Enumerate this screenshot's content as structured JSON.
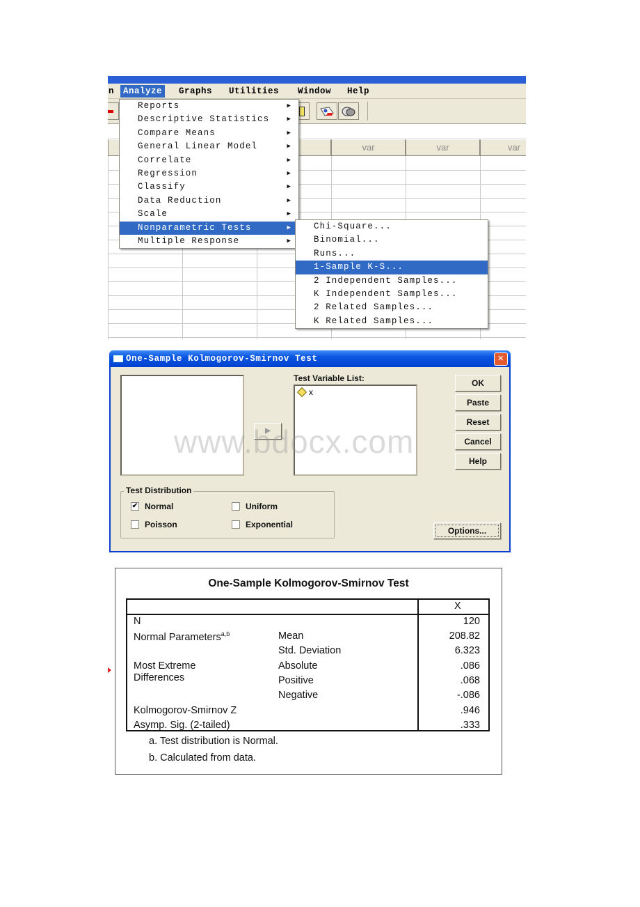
{
  "spss_editor": {
    "menubar": [
      {
        "label": "n",
        "active": false
      },
      {
        "label": "Analyze",
        "active": true
      },
      {
        "label": "Graphs",
        "active": false
      },
      {
        "label": "Utilities",
        "active": false
      },
      {
        "label": "Window",
        "active": false
      },
      {
        "label": "Help",
        "active": false
      }
    ],
    "toolbar_icons": [
      "value-labels-icon",
      "use-sets-icon"
    ],
    "column_headers": [
      "r",
      "var",
      "var",
      "var"
    ],
    "analyze_menu": [
      {
        "label": "Reports",
        "submenu": true
      },
      {
        "label": "Descriptive Statistics",
        "submenu": true
      },
      {
        "label": "Compare Means",
        "submenu": true
      },
      {
        "label": "General Linear Model",
        "submenu": true
      },
      {
        "label": "Correlate",
        "submenu": true
      },
      {
        "label": "Regression",
        "submenu": true
      },
      {
        "label": "Classify",
        "submenu": true
      },
      {
        "label": "Data Reduction",
        "submenu": true
      },
      {
        "label": "Scale",
        "submenu": true
      },
      {
        "label": "Nonparametric Tests",
        "submenu": true,
        "selected": true
      },
      {
        "label": "Multiple Response",
        "submenu": true
      }
    ],
    "nonparametric_menu": [
      {
        "label": "Chi-Square..."
      },
      {
        "label": "Binomial..."
      },
      {
        "label": "Runs..."
      },
      {
        "label": "1-Sample K-S...",
        "selected": true
      },
      {
        "label": "2 Independent Samples..."
      },
      {
        "label": "K Independent Samples..."
      },
      {
        "label": "2 Related Samples..."
      },
      {
        "label": "K Related Samples..."
      }
    ],
    "highlight_color": "#316ac5"
  },
  "ks_dialog": {
    "title": "One-Sample Kolmogorov-Smirnov Test",
    "test_variable_label": "Test Variable List:",
    "test_variables": [
      "x"
    ],
    "buttons": {
      "ok": "OK",
      "paste": "Paste",
      "reset": "Reset",
      "cancel": "Cancel",
      "help": "Help",
      "options": "Options..."
    },
    "test_distribution": {
      "label": "Test Distribution",
      "options": [
        {
          "label": "Normal",
          "checked": true
        },
        {
          "label": "Uniform",
          "checked": false
        },
        {
          "label": "Poisson",
          "checked": false
        },
        {
          "label": "Exponential",
          "checked": false
        }
      ]
    },
    "watermark": "www.bdocx.com"
  },
  "ks_output": {
    "title": "One-Sample Kolmogorov-Smirnov Test",
    "column_header": "X",
    "rows": [
      {
        "label": "N",
        "sublabel": "",
        "value": "120"
      },
      {
        "label": "Normal Parameters",
        "sup": "a,b",
        "sublabel": "Mean",
        "value": "208.82"
      },
      {
        "label": "",
        "sublabel": "Std. Deviation",
        "value": "6.323"
      },
      {
        "label": "Most Extreme",
        "sublabel": "Absolute",
        "value": ".086"
      },
      {
        "label": "Differences",
        "sublabel": "Positive",
        "value": ".068"
      },
      {
        "label": "",
        "sublabel": "Negative",
        "value": "-.086"
      },
      {
        "label": "Kolmogorov-Smirnov Z",
        "sublabel": "",
        "value": ".946"
      },
      {
        "label": "Asymp. Sig. (2-tailed)",
        "sublabel": "",
        "value": ".333"
      }
    ],
    "footnotes": [
      "a. Test distribution is Normal.",
      "b. Calculated from data."
    ]
  }
}
